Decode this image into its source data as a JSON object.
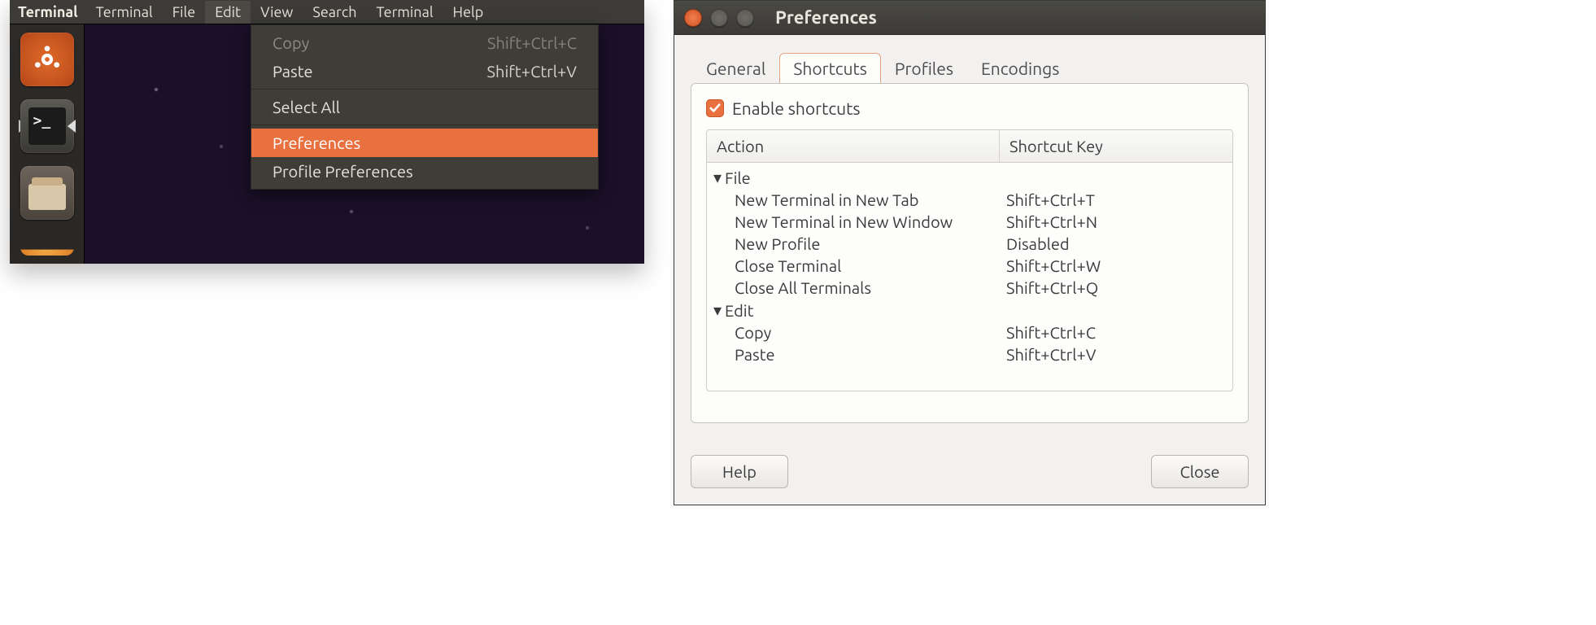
{
  "menubar": {
    "app_title": "Terminal",
    "items": [
      "Terminal",
      "File",
      "Edit",
      "View",
      "Search",
      "Terminal",
      "Help"
    ],
    "open_index": 2
  },
  "edit_menu": {
    "rows": [
      {
        "label": "Copy",
        "accel": "Shift+Ctrl+C",
        "disabled": true
      },
      {
        "label": "Paste",
        "accel": "Shift+Ctrl+V",
        "disabled": false
      },
      {
        "sep": true
      },
      {
        "label": "Select All",
        "accel": "",
        "disabled": false
      },
      {
        "sep": true
      },
      {
        "label": "Preferences",
        "accel": "",
        "highlight": true
      },
      {
        "label": "Profile Preferences",
        "accel": "",
        "disabled": false
      }
    ]
  },
  "prefs": {
    "title": "Preferences",
    "tabs": [
      "General",
      "Shortcuts",
      "Profiles",
      "Encodings"
    ],
    "active_tab": 1,
    "enable_shortcuts_label": "Enable shortcuts",
    "enable_shortcuts_checked": true,
    "columns": {
      "action": "Action",
      "key": "Shortcut Key"
    },
    "groups": [
      {
        "name": "File",
        "rows": [
          {
            "action": "New Terminal in New Tab",
            "key": "Shift+Ctrl+T"
          },
          {
            "action": "New Terminal in New Window",
            "key": "Shift+Ctrl+N"
          },
          {
            "action": "New Profile",
            "key": "Disabled"
          },
          {
            "action": "Close Terminal",
            "key": "Shift+Ctrl+W"
          },
          {
            "action": "Close All Terminals",
            "key": "Shift+Ctrl+Q"
          }
        ]
      },
      {
        "name": "Edit",
        "rows": [
          {
            "action": "Copy",
            "key": "Shift+Ctrl+C"
          },
          {
            "action": "Paste",
            "key": "Shift+Ctrl+V"
          }
        ]
      }
    ],
    "buttons": {
      "help": "Help",
      "close": "Close"
    }
  }
}
